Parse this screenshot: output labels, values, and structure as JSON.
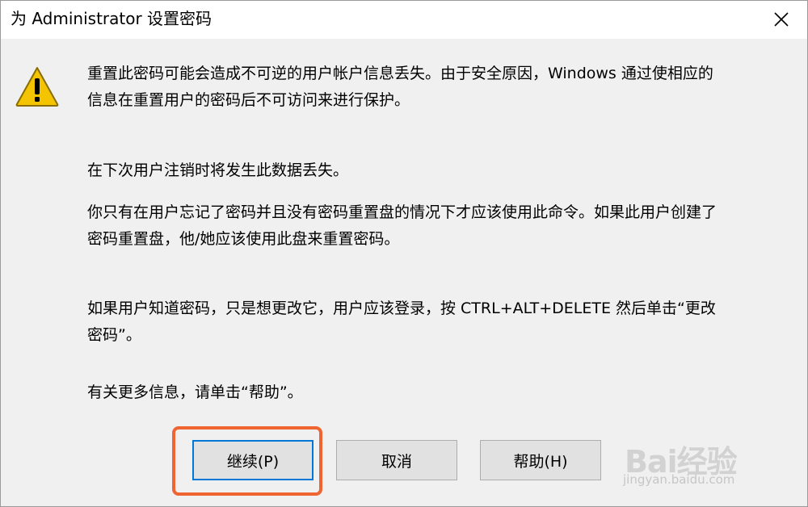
{
  "window": {
    "title": "为 Administrator 设置密码",
    "close_icon": "close-icon"
  },
  "content": {
    "icon": "warning-icon",
    "paragraphs": [
      "重置此密码可能会造成不可逆的用户帐户信息丢失。由于安全原因，Windows 通过使相应的",
      "信息在重置用户的密码后不可访问来进行保护。",
      "在下次用户注销时将发生此数据丢失。",
      "你只有在用户忘记了密码并且没有密码重置盘的情况下才应该使用此命令。如果此用户创建了",
      "密码重置盘，他/她应该使用此盘来重置密码。",
      "如果用户知道密码，只是想更改它，用户应该登录，按 CTRL+ALT+DELETE 然后单击“更改",
      "密码”。",
      "有关更多信息，请单击“帮助”。"
    ]
  },
  "buttons": {
    "continue": "继续(P)",
    "cancel": "取消",
    "help": "帮助(H)"
  },
  "colors": {
    "highlight": "#f06432",
    "focus": "#0078d7",
    "warning_fill": "#f5c400"
  },
  "watermark": {
    "brand": "Bai经验",
    "url": "jingyan.baidu.com"
  }
}
